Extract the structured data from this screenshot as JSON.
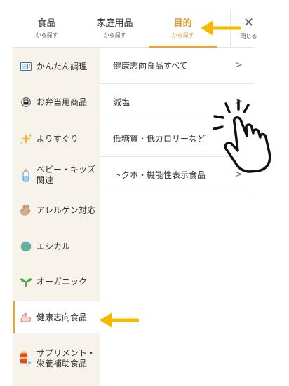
{
  "tabs": [
    {
      "label": "食品",
      "sub": "から探す",
      "active": false
    },
    {
      "label": "家庭用品",
      "sub": "から探す",
      "active": false
    },
    {
      "label": "目的",
      "sub": "から探す",
      "active": true
    }
  ],
  "close": {
    "label": "閉じる"
  },
  "sidebar": {
    "items": [
      {
        "label": "かんたん調理",
        "icon": "microwave-icon"
      },
      {
        "label": "お弁当用商品",
        "icon": "bento-icon"
      },
      {
        "label": "よりすぐり",
        "icon": "sparkle-icon"
      },
      {
        "label": "ベビー・キッズ関連",
        "icon": "baby-bottle-icon"
      },
      {
        "label": "アレルゲン対応",
        "icon": "hand-icon"
      },
      {
        "label": "エシカル",
        "icon": "earth-icon"
      },
      {
        "label": "オーガニック",
        "icon": "sprout-icon"
      },
      {
        "label": "健康志向食品",
        "icon": "muscle-icon",
        "active": true
      },
      {
        "label": "サプリメント・栄養補助食品",
        "icon": "supplement-icon"
      }
    ]
  },
  "main": {
    "rows": [
      {
        "label": "健康志向食品すべて"
      },
      {
        "label": "減塩"
      },
      {
        "label": "低糖質・低カロリーなど"
      },
      {
        "label": "トクホ・機能性表示食品"
      }
    ]
  },
  "colors": {
    "accent": "#e8a33d",
    "sidebar_bg": "#f8f3ea",
    "arrow": "#f4b800"
  }
}
